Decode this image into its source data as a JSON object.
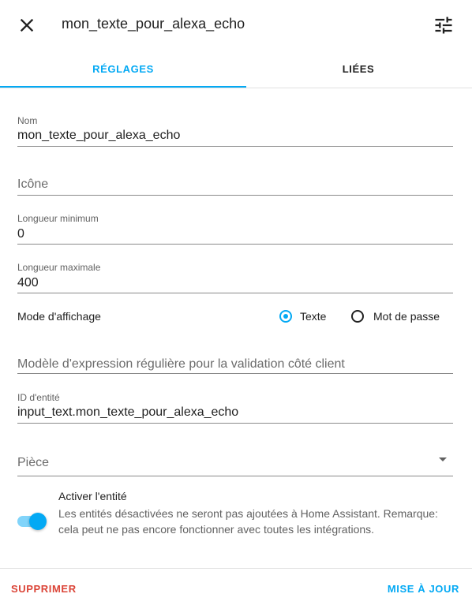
{
  "header": {
    "title": "mon_texte_pour_alexa_echo",
    "close_icon": "close-icon",
    "settings_icon": "tune-icon"
  },
  "tabs": [
    {
      "label": "RÉGLAGES",
      "active": true
    },
    {
      "label": "LIÉES",
      "active": false
    }
  ],
  "form": {
    "name": {
      "label": "Nom",
      "value": "mon_texte_pour_alexa_echo"
    },
    "icon": {
      "placeholder": "Icône"
    },
    "min_length": {
      "label": "Longueur minimum",
      "value": "0"
    },
    "max_length": {
      "label": "Longueur maximale",
      "value": "400"
    },
    "display_mode": {
      "label": "Mode d'affichage",
      "options": [
        {
          "label": "Texte",
          "checked": true
        },
        {
          "label": "Mot de passe",
          "checked": false
        }
      ]
    },
    "pattern": {
      "placeholder": "Modèle d'expression régulière pour la validation côté client"
    },
    "entity_id": {
      "label": "ID d'entité",
      "value": "input_text.mon_texte_pour_alexa_echo"
    },
    "area": {
      "placeholder": "Pièce"
    },
    "enable": {
      "title": "Activer l'entité",
      "description": "Les entités désactivées ne seront pas ajoutées à Home Assistant. Remarque: cela peut ne pas encore fonctionner avec toutes les intégrations.",
      "enabled": true
    }
  },
  "footer": {
    "delete_label": "SUPPRIMER",
    "update_label": "MISE À JOUR"
  },
  "colors": {
    "accent": "#03a9f4",
    "danger": "#db4437",
    "text": "#212121",
    "secondary_text": "#616161"
  }
}
